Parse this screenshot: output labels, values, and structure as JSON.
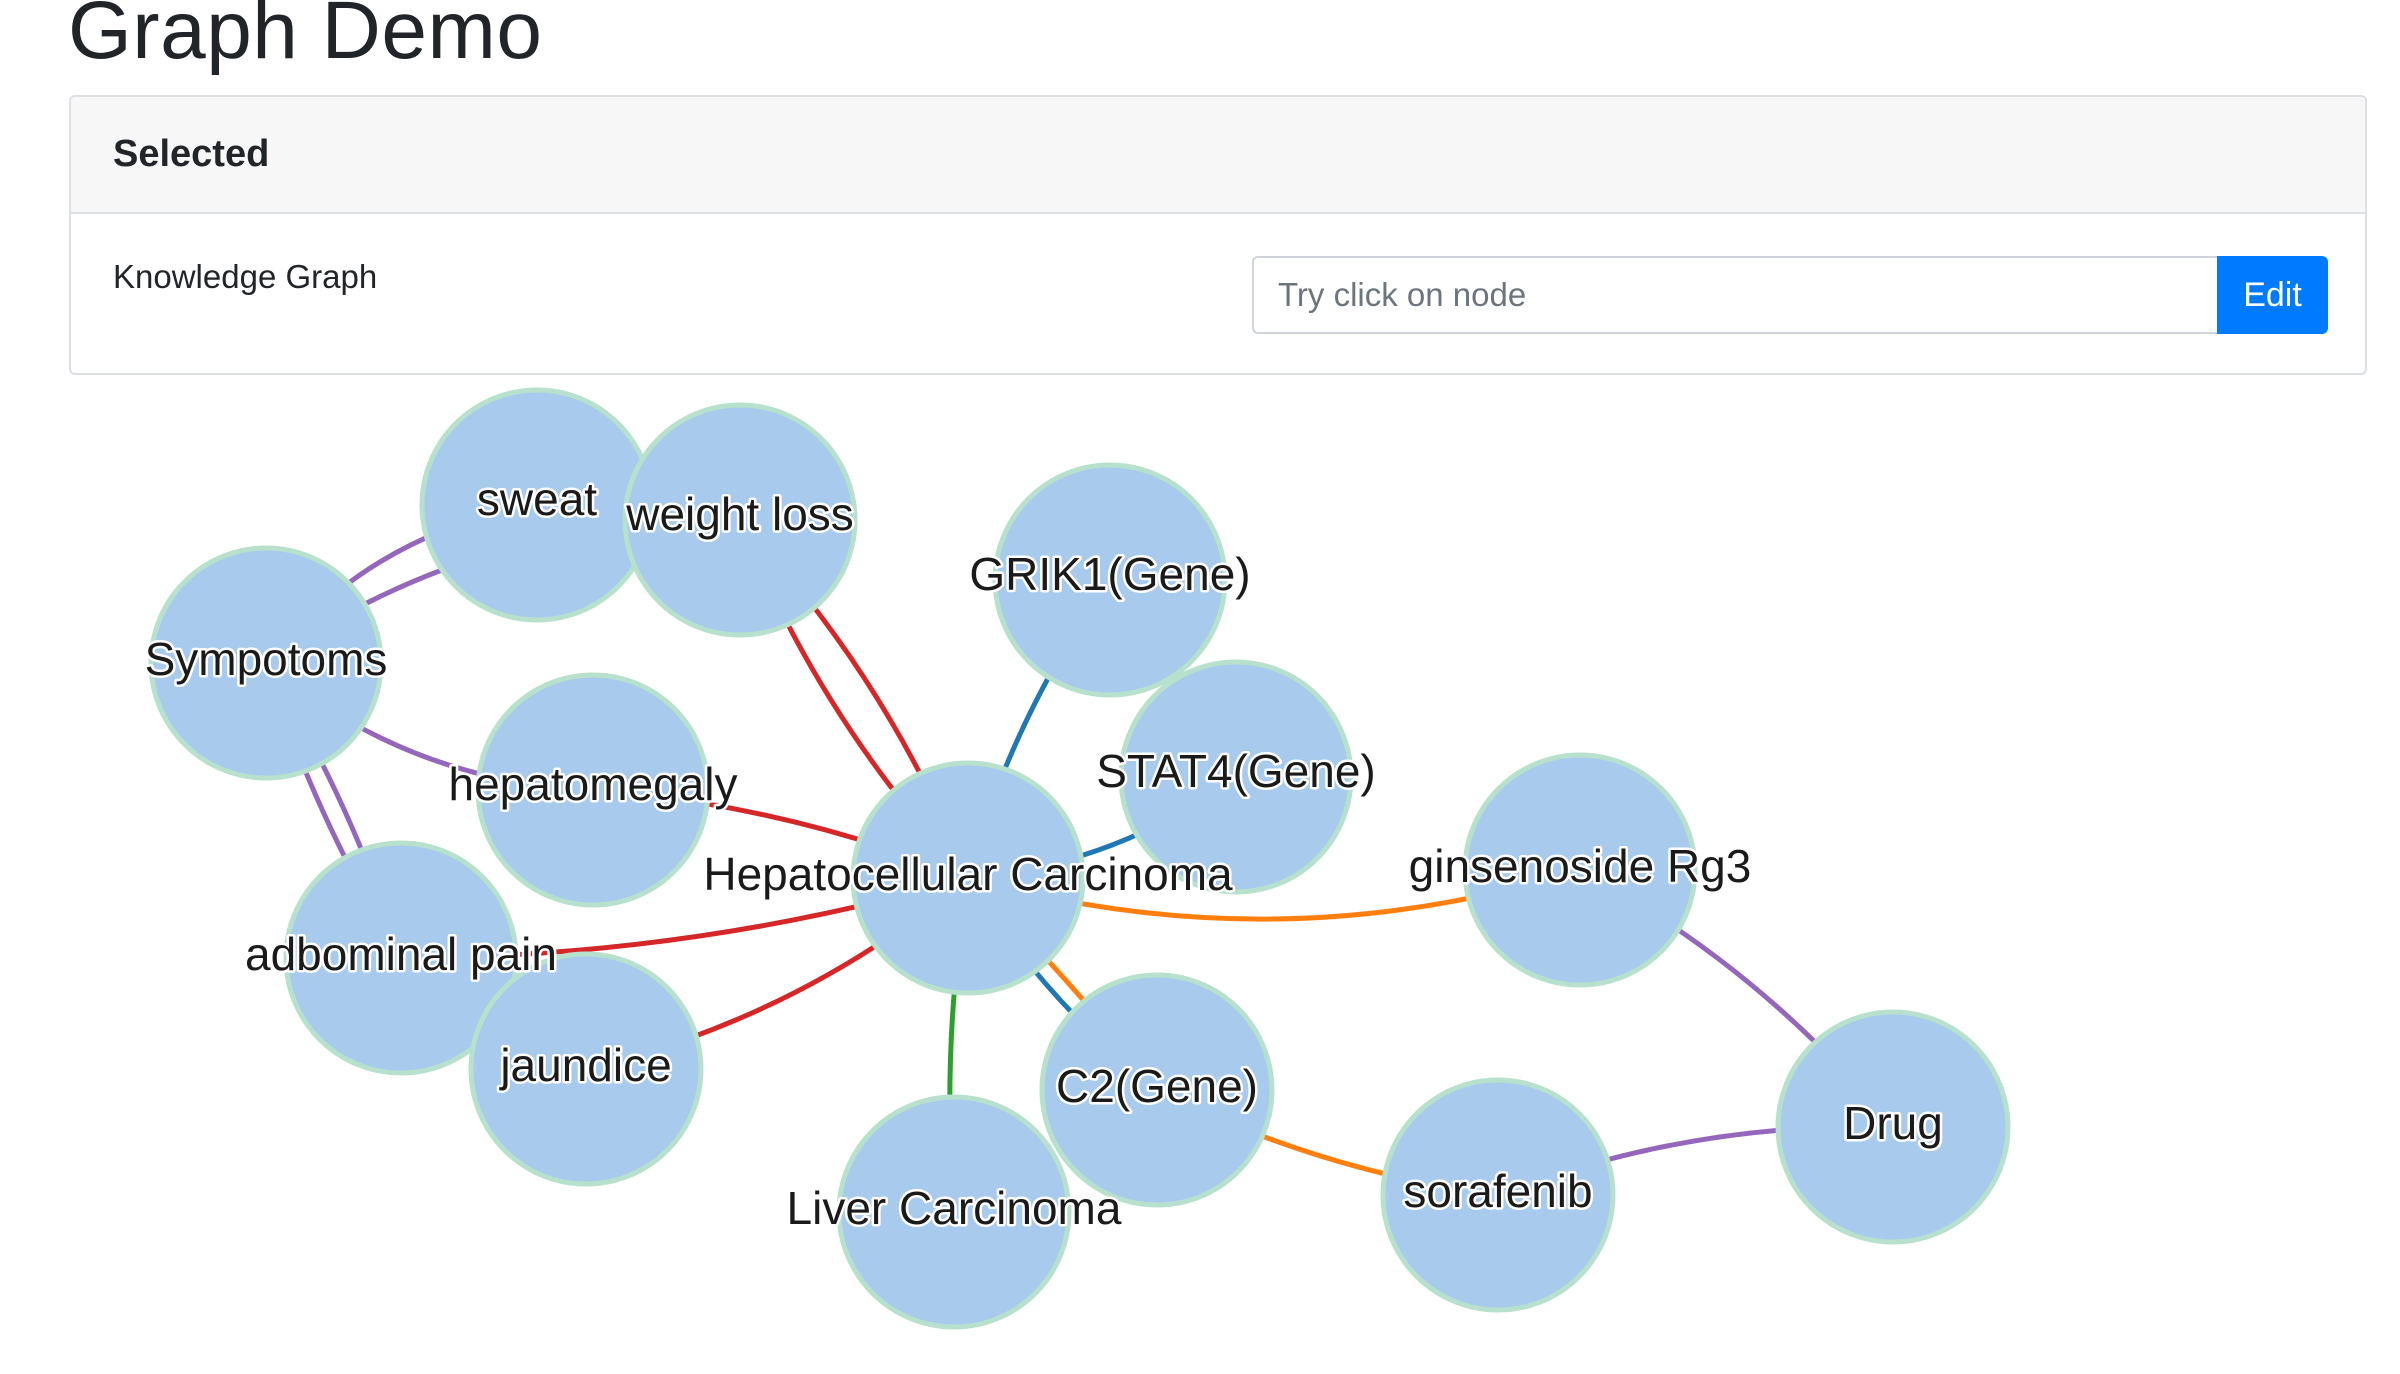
{
  "page": {
    "title": "Graph Demo"
  },
  "card": {
    "header": "Selected",
    "label": "Knowledge Graph",
    "input_placeholder": "Try click on node",
    "input_value": "",
    "edit_label": "Edit"
  },
  "graph": {
    "colors": {
      "node_fill": "#a7caed",
      "node_stroke": "#b7e1cd",
      "symptom_edge": "#9467bd",
      "disease_edge": "#d62728",
      "gene_edge": "#1f77b4",
      "drug_edge": "#ff7f0e",
      "subclass_edge": "#2ca02c"
    },
    "nodes": [
      {
        "id": "sweat",
        "label": "sweat"
      },
      {
        "id": "weight-loss",
        "label": "weight loss"
      },
      {
        "id": "sympotoms",
        "label": "Sympotoms"
      },
      {
        "id": "hepatomegaly",
        "label": "hepatomegaly"
      },
      {
        "id": "adbominal-pain",
        "label": "adbominal pain"
      },
      {
        "id": "jaundice",
        "label": "jaundice"
      },
      {
        "id": "grik1",
        "label": "GRIK1(Gene)"
      },
      {
        "id": "stat4",
        "label": "STAT4(Gene)"
      },
      {
        "id": "hcc",
        "label": "Hepatocellular Carcinoma"
      },
      {
        "id": "ginsenoside",
        "label": "ginsenoside Rg3"
      },
      {
        "id": "drug",
        "label": "Drug"
      },
      {
        "id": "c2",
        "label": "C2(Gene)"
      },
      {
        "id": "sorafenib",
        "label": "sorafenib"
      },
      {
        "id": "liver-carcinoma",
        "label": "Liver Carcinoma"
      }
    ],
    "edges": [
      {
        "source": "sympotoms",
        "target": "sweat",
        "color": "#9467bd"
      },
      {
        "source": "sympotoms",
        "target": "weight-loss",
        "color": "#9467bd"
      },
      {
        "source": "sympotoms",
        "target": "hepatomegaly",
        "color": "#9467bd"
      },
      {
        "source": "sympotoms",
        "target": "adbominal-pain",
        "color": "#9467bd"
      },
      {
        "source": "sympotoms",
        "target": "adbominal-pain",
        "color": "#9467bd"
      },
      {
        "source": "hcc",
        "target": "weight-loss",
        "color": "#d62728"
      },
      {
        "source": "hcc",
        "target": "weight-loss",
        "color": "#d62728"
      },
      {
        "source": "hcc",
        "target": "hepatomegaly",
        "color": "#d62728"
      },
      {
        "source": "hcc",
        "target": "adbominal-pain",
        "color": "#d62728"
      },
      {
        "source": "hcc",
        "target": "jaundice",
        "color": "#d62728"
      },
      {
        "source": "hcc",
        "target": "grik1",
        "color": "#1f77b4"
      },
      {
        "source": "hcc",
        "target": "stat4",
        "color": "#1f77b4"
      },
      {
        "source": "hcc",
        "target": "c2",
        "color": "#1f77b4"
      },
      {
        "source": "hcc",
        "target": "c2",
        "color": "#ff7f0e"
      },
      {
        "source": "hcc",
        "target": "ginsenoside",
        "color": "#ff7f0e"
      },
      {
        "source": "hcc",
        "target": "liver-carcinoma",
        "color": "#2ca02c"
      },
      {
        "source": "c2",
        "target": "sorafenib",
        "color": "#ff7f0e"
      },
      {
        "source": "ginsenoside",
        "target": "drug",
        "color": "#9467bd"
      },
      {
        "source": "sorafenib",
        "target": "drug",
        "color": "#9467bd"
      }
    ]
  }
}
